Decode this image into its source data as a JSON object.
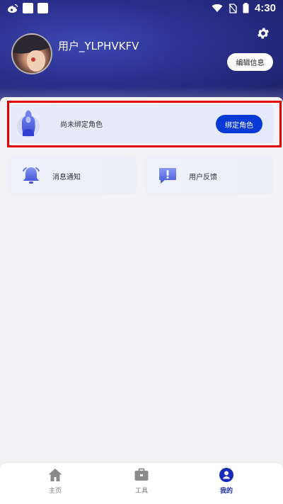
{
  "status_bar": {
    "time": "4:30"
  },
  "profile": {
    "username": "用户_YLPHVKFV",
    "edit_button": "编辑信息"
  },
  "bind_card": {
    "text": "尚未绑定角色",
    "button": "绑定角色"
  },
  "tiles": [
    {
      "label": "消息通知",
      "icon": "bell-icon"
    },
    {
      "label": "用户反馈",
      "icon": "feedback-icon"
    }
  ],
  "bottom_nav": [
    {
      "label": "主页",
      "icon": "home-icon",
      "active": false
    },
    {
      "label": "工具",
      "icon": "toolbox-icon",
      "active": false
    },
    {
      "label": "我的",
      "icon": "user-icon",
      "active": true
    }
  ],
  "colors": {
    "accent": "#0a3ad6",
    "header": "#2a2f8c",
    "highlight": "#e50000",
    "active_nav": "#1a2bb8"
  }
}
